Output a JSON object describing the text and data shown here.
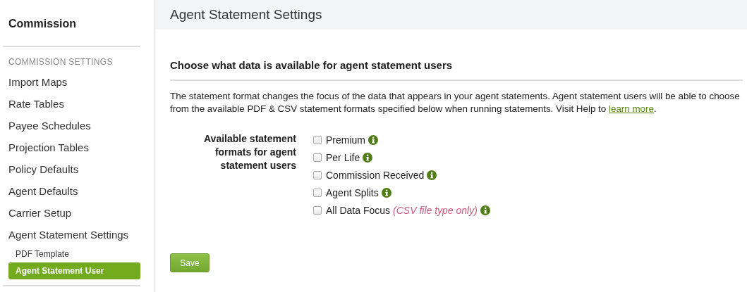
{
  "sidebar": {
    "title": "Commission",
    "section": "COMMISSION SETTINGS",
    "items": [
      {
        "label": "Import Maps",
        "kind": "item",
        "selected": false
      },
      {
        "label": "Rate Tables",
        "kind": "item",
        "selected": false
      },
      {
        "label": "Payee Schedules",
        "kind": "item",
        "selected": false
      },
      {
        "label": "Projection Tables",
        "kind": "item",
        "selected": false
      },
      {
        "label": "Policy Defaults",
        "kind": "item",
        "selected": false
      },
      {
        "label": "Agent Defaults",
        "kind": "item",
        "selected": false
      },
      {
        "label": "Carrier Setup",
        "kind": "item",
        "selected": false
      },
      {
        "label": "Agent Statement Settings",
        "kind": "item",
        "selected": false
      },
      {
        "label": "PDF Template",
        "kind": "subitem",
        "selected": false
      },
      {
        "label": "Agent Statement User",
        "kind": "subitem",
        "selected": true
      }
    ]
  },
  "page": {
    "title": "Agent Statement Settings",
    "section_title": "Choose what data is available for agent statement users",
    "description": {
      "text": "The statement format changes the focus of the data that appears in your agent statements. Agent statement users will be able to choose from the available PDF & CSV statement formats specified below when running statements. Visit Help to ",
      "link": "learn more",
      "after": "."
    },
    "form_label": "Available statement formats for agent statement users",
    "options": [
      {
        "label": "Premium",
        "checked": false
      },
      {
        "label": "Per Life",
        "checked": false
      },
      {
        "label": "Commission Received",
        "checked": false
      },
      {
        "label": "Agent Splits",
        "checked": false
      },
      {
        "label": "All Data Focus",
        "note": "(CSV file type only)",
        "checked": false
      }
    ],
    "save_button": "Save"
  }
}
